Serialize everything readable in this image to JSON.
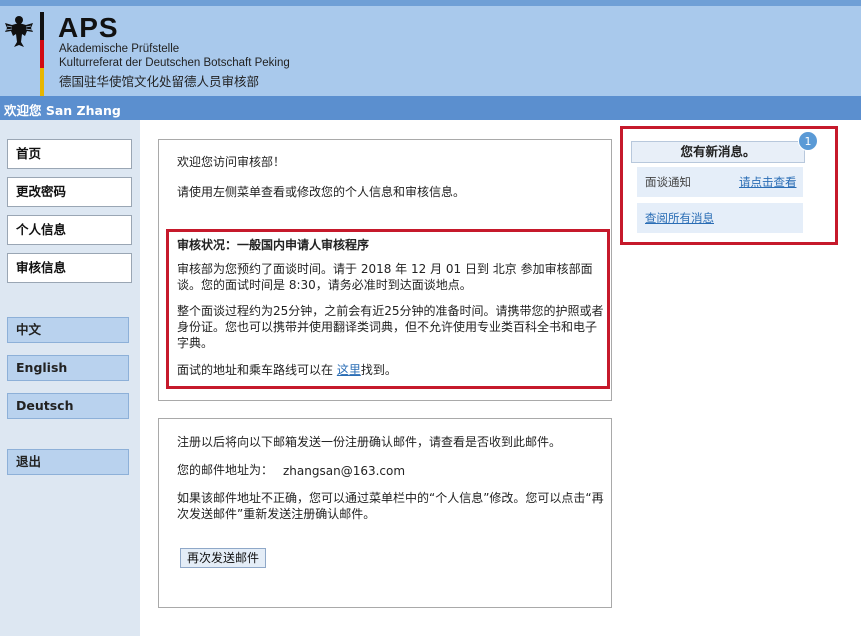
{
  "header": {
    "title": "APS",
    "line1": "Akademische Prüfstelle",
    "line2": "Kulturreferat der Deutschen Botschaft Peking",
    "line3": "德国驻华使馆文化处留德人员审核部"
  },
  "welcome": "欢迎您 San Zhang",
  "nav": {
    "home": "首页",
    "change_password": "更改密码",
    "personal_info": "个人信息",
    "review_info": "审核信息"
  },
  "languages": {
    "zh": "中文",
    "en": "English",
    "de": "Deutsch"
  },
  "logout": "退出",
  "intro": {
    "greeting": "欢迎您访问审核部！",
    "instruction": "请使用左侧菜单查看或修改您的个人信息和审核信息。"
  },
  "status": {
    "heading": "审核状况：一般国内申请人审核程序",
    "appt_line1": "审核部为您预约了面谈时间。请于 2018 年 12 月 01 日到 北京 参加审核部面",
    "appt_line2": "谈。您的面试时间是 8:30，请务必准时到达面谈地点。",
    "prep_line1": "整个面谈过程约为25分钟，之前会有近25分钟的准备时间。请携带您的护照或者",
    "prep_line2": "身份证。您也可以携带并使用翻译类词典，但不允许使用专业类百科全书和电子",
    "prep_line3": "字典。",
    "address_prefix": "面试的地址和乘车路线可以在",
    "address_link": "这里",
    "address_suffix": "找到。"
  },
  "email": {
    "sent_note": "注册以后将向以下邮箱发送一份注册确认邮件，请查看是否收到此邮件。",
    "label": "您的邮件地址为：",
    "address": "zhangsan@163.com",
    "wrong_line1": "如果该邮件地址不正确，您可以通过菜单栏中的“个人信息”修改。您可以点击“再",
    "wrong_line2": "次发送邮件”重新发送注册确认邮件。",
    "resend_button": "再次发送邮件"
  },
  "messages": {
    "title": "您有新消息。",
    "badge_count": "1",
    "item_label": "面谈通知",
    "item_link": "请点击查看",
    "view_all": "查阅所有消息"
  },
  "colors": {
    "header_bg": "#a9c9ec",
    "welcome_bar": "#5b8fcf",
    "highlight_red": "#c6192b",
    "link": "#2a6db5"
  }
}
